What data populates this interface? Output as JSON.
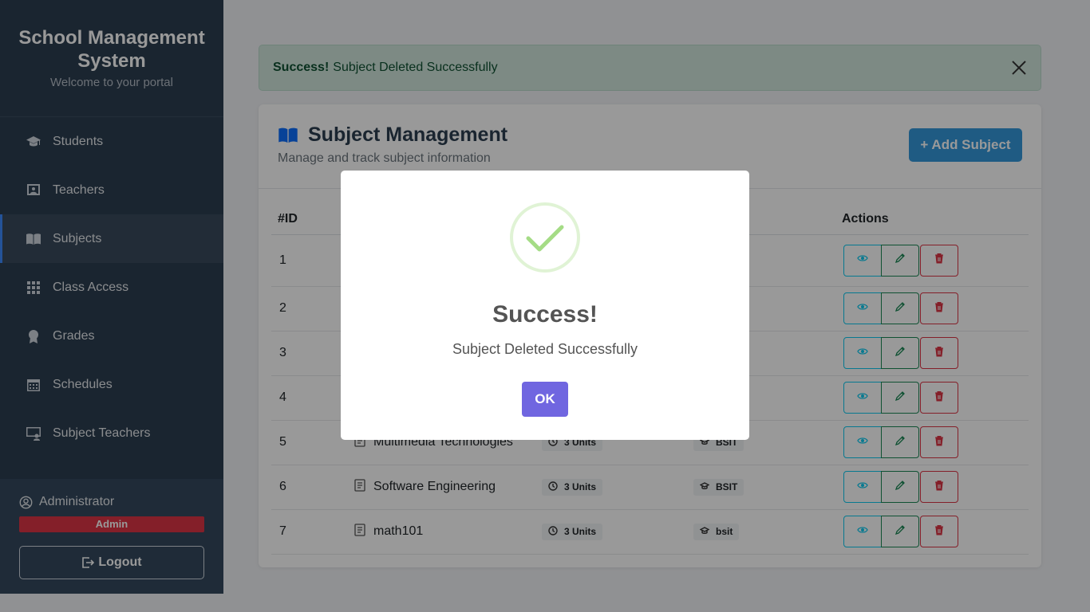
{
  "sidebar": {
    "title": "School Management System",
    "subtitle": "Welcome to your portal",
    "items": [
      {
        "label": "Students",
        "icon": "graduation-cap-icon"
      },
      {
        "label": "Teachers",
        "icon": "teacher-board-icon"
      },
      {
        "label": "Subjects",
        "icon": "book-icon",
        "active": true
      },
      {
        "label": "Class Access",
        "icon": "grid-icon"
      },
      {
        "label": "Grades",
        "icon": "award-icon"
      },
      {
        "label": "Schedules",
        "icon": "calendar-icon"
      },
      {
        "label": "Subject Teachers",
        "icon": "person-screen-icon"
      }
    ],
    "user_name": "Administrator",
    "user_role": "Admin",
    "logout_label": "Logout"
  },
  "alert": {
    "strong": "Success!",
    "message": "Subject Deleted Successfully"
  },
  "card": {
    "title": "Subject Management",
    "subtitle": "Manage and track subject information",
    "add_label": "+ Add Subject"
  },
  "table": {
    "headers": {
      "id": "#ID",
      "actions": "Actions"
    },
    "rows": [
      {
        "id": "1",
        "name": "",
        "units": "",
        "program": ""
      },
      {
        "id": "2",
        "name": "",
        "units": "",
        "program": ""
      },
      {
        "id": "3",
        "name": "",
        "units": "",
        "program": ""
      },
      {
        "id": "4",
        "name": "",
        "units": "",
        "program": ""
      },
      {
        "id": "5",
        "name": "Multimedia Technologies",
        "units": "3 Units",
        "program": "BSIT"
      },
      {
        "id": "6",
        "name": "Software Engineering",
        "units": "3 Units",
        "program": "BSIT"
      },
      {
        "id": "7",
        "name": "math101",
        "units": "3 Units",
        "program": "bsit"
      }
    ]
  },
  "modal": {
    "title": "Success!",
    "text": "Subject Deleted Successfully",
    "ok_label": "OK"
  },
  "colors": {
    "sidebar_bg": "#2c3e50",
    "primary": "#3498db",
    "danger": "#dc3545",
    "confirm": "#7066e0",
    "success_check": "#a5dc86"
  }
}
